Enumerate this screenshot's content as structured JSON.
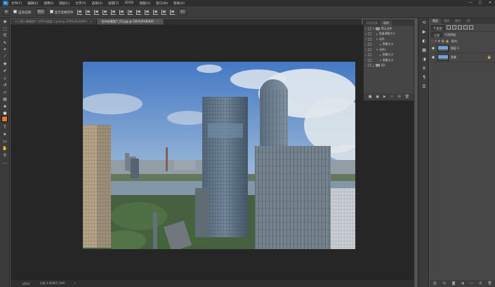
{
  "menubar": {
    "logo": "Ps",
    "items": [
      "文件(F)",
      "编辑(E)",
      "图像(I)",
      "图层(L)",
      "文字(Y)",
      "选择(S)",
      "滤镜(T)",
      "3D(D)",
      "视图(V)",
      "窗口(W)",
      "帮助(H)"
    ],
    "window_controls": [
      "—",
      "□",
      "✕"
    ]
  },
  "options": {
    "auto_select_label": "自动选择:",
    "auto_select_target": "图层",
    "show_transform_label": "显示变换控件"
  },
  "doc_tabs": [
    {
      "label": "入门课人像精修(*.100%(图层 1.psd @ 100%(RGB/8#)",
      "active": false
    },
    {
      "label": "合并结果图(*_03.jpg @ 100%(RGB/8#)",
      "active": true
    }
  ],
  "status": {
    "zoom": "100%",
    "doc_info": "文档:3.06M/5.10M"
  },
  "history_panel": {
    "tabs": [
      "历史记录",
      "动作"
    ],
    "rows": [
      {
        "indent": 0,
        "type": "folder",
        "label": "默认动作"
      },
      {
        "indent": 1,
        "type": "action",
        "label": "批量调整大小"
      },
      {
        "indent": 1,
        "type": "folder",
        "label": "动作"
      },
      {
        "indent": 2,
        "type": "action",
        "label": "图像大小"
      },
      {
        "indent": 1,
        "type": "folder",
        "label": "动作1"
      },
      {
        "indent": 2,
        "type": "action",
        "label": "图像大小"
      },
      {
        "indent": 2,
        "type": "action",
        "label": "图像大小"
      },
      {
        "indent": 0,
        "type": "folder",
        "label": "组1"
      }
    ]
  },
  "layers_panel": {
    "tabs": [
      "图层",
      "通道",
      "路径",
      "3D"
    ],
    "filter_kind": "P 类型",
    "blend_mode": "正常",
    "opacity_label": "不透明度:",
    "fill_label": "填充:",
    "layers": [
      {
        "name": "图层 1",
        "locked": false
      },
      {
        "name": "背景",
        "locked": true
      }
    ]
  }
}
